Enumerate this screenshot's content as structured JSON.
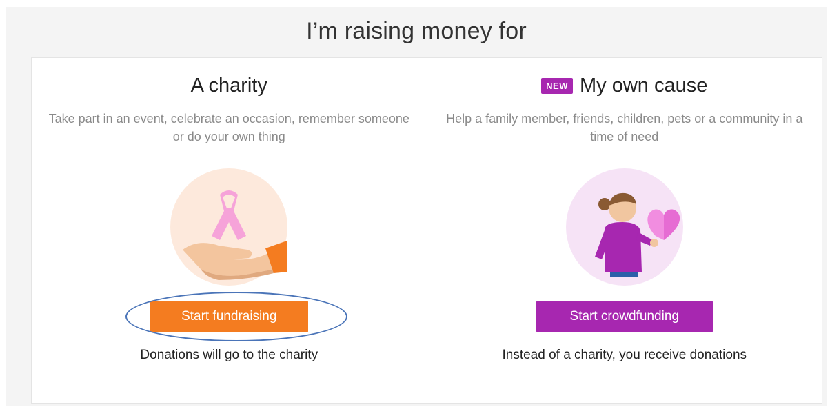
{
  "heading": "I’m raising money for",
  "cards": [
    {
      "title": "A charity",
      "description": "Take part in an event, celebrate an occasion, remember someone or do your own thing",
      "button_label": "Start fundraising",
      "note": "Donations will go to the charity",
      "illustration_icon": "ribbon-hand-icon"
    },
    {
      "badge": "NEW",
      "title": "My own cause",
      "description": "Help a family member, friends, children, pets or a community in a time of need",
      "button_label": "Start crowdfunding",
      "note": "Instead of a charity, you receive donations",
      "illustration_icon": "person-heart-icon"
    }
  ],
  "colors": {
    "charity_accent": "#f47c20",
    "cause_accent": "#a727b0",
    "annotation_ring": "#4a74b8"
  }
}
